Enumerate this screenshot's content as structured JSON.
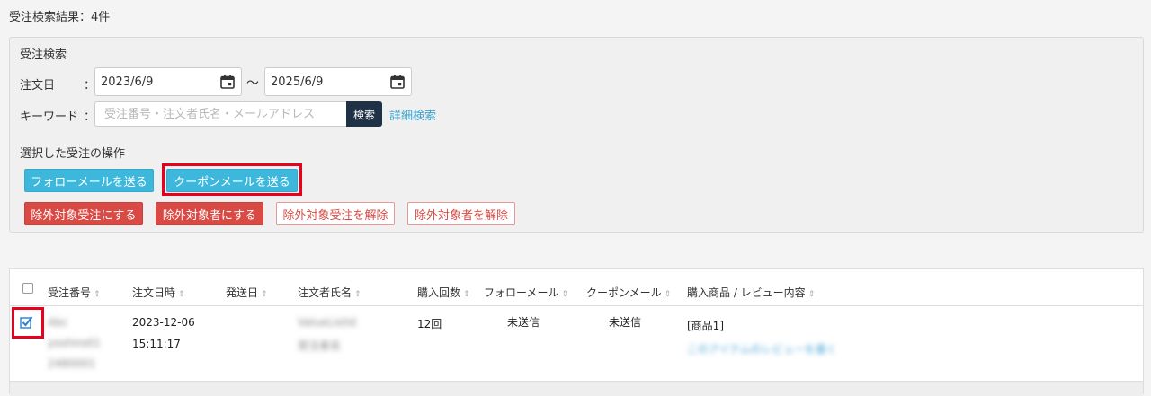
{
  "page": {
    "title": "受注検索結果：4件"
  },
  "search": {
    "title": "受注検索",
    "order_date_label": "注文日",
    "colon": "：",
    "date_from": "2023/6/9",
    "date_to": "2025/6/9",
    "range_sep": "～",
    "keyword_label": "キーワード",
    "keyword_colon": "：",
    "keyword_placeholder": "受注番号・注文者氏名・メールアドレス",
    "keyword_value": "",
    "search_button": "検索",
    "advanced_link": "詳細検索"
  },
  "operations": {
    "title": "選択した受注の操作",
    "follow_mail": "フォローメールを送る",
    "coupon_mail": "クーポンメールを送る",
    "exclude_order": "除外対象受注にする",
    "exclude_customer": "除外対象者にする",
    "unexclude_order": "除外対象受注を解除",
    "unexclude_customer": "除外対象者を解除"
  },
  "table": {
    "columns": [
      "受注番号",
      "注文日時",
      "発送日",
      "注文者氏名",
      "購入回数",
      "フォローメール",
      "クーポンメール",
      "購入商品 / レビュー内容"
    ],
    "sort_glyph": "⇕",
    "rows": [
      {
        "order_no": [
          "Abc",
          "yoshiro01",
          "2480001"
        ],
        "date": "2023-12-06",
        "time": "15:11:17",
        "ship_date": "",
        "customer": [
          "ValueListId",
          "受注者名"
        ],
        "purchase_count": "12回",
        "follow_mail": "未送信",
        "coupon_mail": "未送信",
        "product": "[商品1]",
        "review": "このアイテムのレビューを書く"
      }
    ]
  },
  "colors": {
    "info": "#3db8dc",
    "danger": "#d94a44",
    "dark": "#1f3147",
    "link": "#3aa4cf",
    "highlight": "#e8001c"
  }
}
